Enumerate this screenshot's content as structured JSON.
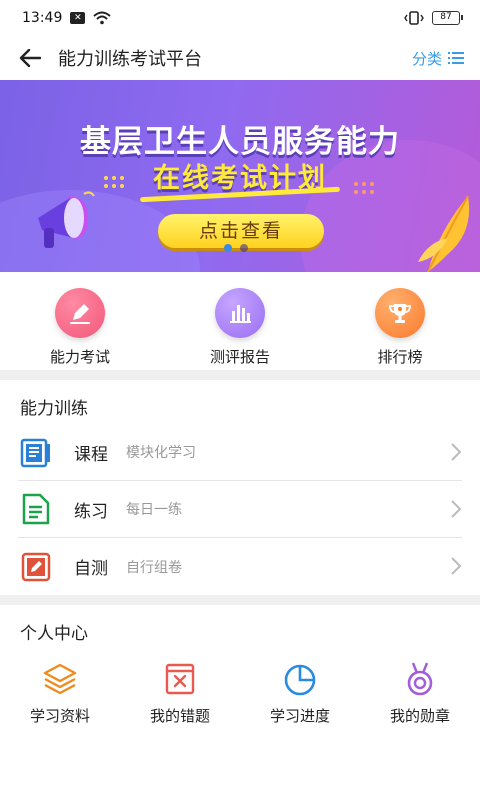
{
  "status": {
    "time": "13:49",
    "battery": "87"
  },
  "header": {
    "title": "能力训练考试平台",
    "category_label": "分类"
  },
  "banner": {
    "headline": "基层卫生人员服务能力",
    "subline": "在线考试计划",
    "button_label": "点击查看",
    "page_count": 2,
    "current_page": 1
  },
  "quick_actions": [
    {
      "label": "能力考试",
      "icon": "pen-icon",
      "color": "#f2577a"
    },
    {
      "label": "测评报告",
      "icon": "bar-chart-icon",
      "color": "#9a6df2"
    },
    {
      "label": "排行榜",
      "icon": "trophy-icon",
      "color": "#fb7a2b"
    }
  ],
  "training": {
    "title": "能力训练",
    "items": [
      {
        "name": "课程",
        "desc": "模块化学习",
        "icon": "book-icon",
        "color": "#2a7fd6"
      },
      {
        "name": "练习",
        "desc": "每日一练",
        "icon": "document-icon",
        "color": "#1aa34a"
      },
      {
        "name": "自测",
        "desc": "自行组卷",
        "icon": "pencil-icon",
        "color": "#e0533a"
      }
    ]
  },
  "personal": {
    "title": "个人中心",
    "items": [
      {
        "label": "学习资料",
        "icon": "layers-icon",
        "color": "#f08a1c"
      },
      {
        "label": "我的错题",
        "icon": "error-book-icon",
        "color": "#e85a4f"
      },
      {
        "label": "学习进度",
        "icon": "pie-chart-icon",
        "color": "#2a8ae0"
      },
      {
        "label": "我的勋章",
        "icon": "medal-icon",
        "color": "#a35dd9"
      }
    ]
  }
}
